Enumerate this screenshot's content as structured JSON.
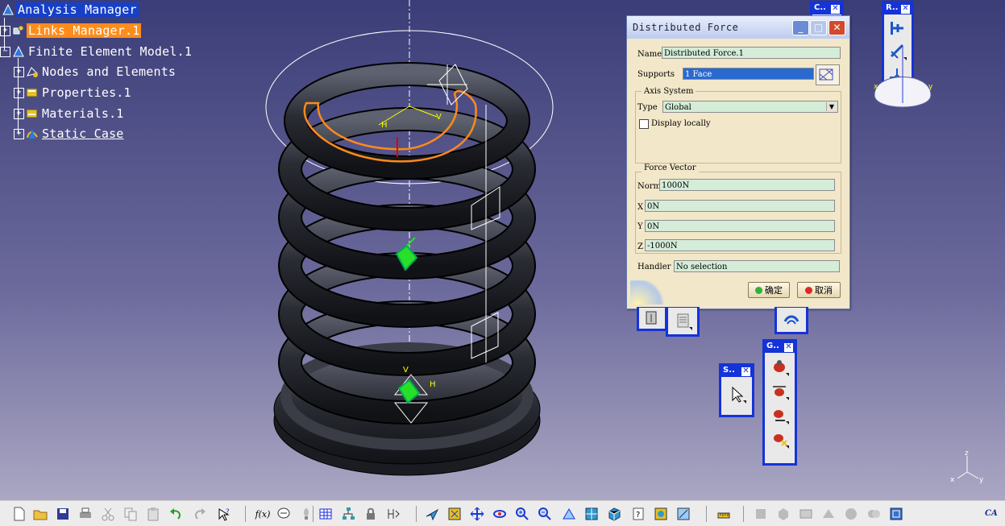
{
  "tree": {
    "items": [
      {
        "label": "Analysis Manager"
      },
      {
        "label": "Links Manager.1"
      },
      {
        "label": "Finite Element Model.1"
      },
      {
        "label": "Nodes and Elements"
      },
      {
        "label": "Properties.1"
      },
      {
        "label": "Materials.1"
      },
      {
        "label": "Static Case"
      }
    ]
  },
  "dialog": {
    "title": "Distributed Force",
    "name_label": "Name",
    "name_value": "Distributed Force.1",
    "supports_label": "Supports",
    "supports_value": "1 Face",
    "axis_group": "Axis System",
    "type_label": "Type",
    "type_value": "Global",
    "display_locally": "Display locally",
    "force_group": "Force Vector",
    "norm_label": "Norm",
    "norm_value": "1000N",
    "x_label": "X",
    "x_value": "0N",
    "y_label": "Y",
    "y_value": "0N",
    "z_label": "Z",
    "z_value": "-1000N",
    "handler_label": "Handler",
    "handler_value": "No selection",
    "ok_label": "确定",
    "cancel_label": "取消"
  },
  "toolbars": {
    "c_title": "C..",
    "r_title": "R..",
    "s_title": "S..",
    "g_title": "G.."
  },
  "viewport": {
    "label_h": "H",
    "label_v": "V",
    "axis_x": "x",
    "axis_y": "y",
    "axis_z": "z",
    "compass_x": "x",
    "compass_y": "y"
  },
  "bottombar": {
    "fx_label": "f(x)",
    "logo_label": "CA"
  },
  "colors": {
    "tree_selected": "#1640c8",
    "tree_active": "#ff8c1a",
    "toolbar_frame": "#1433d8",
    "field_bg": "#d4ecd8",
    "dialog_bg": "#f2e7c9"
  }
}
